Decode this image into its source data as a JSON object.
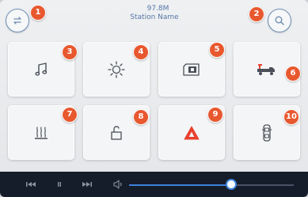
{
  "header": {
    "frequency": "97.8M",
    "station_name": "Station Name"
  },
  "markers": [
    "1",
    "2",
    "3",
    "4",
    "5",
    "6",
    "7",
    "8",
    "9",
    "10"
  ],
  "tiles": [
    {
      "id": "music",
      "icon": "music-note-icon"
    },
    {
      "id": "brightness",
      "icon": "sun-brightness-icon"
    },
    {
      "id": "media-card",
      "icon": "sd-card-icon"
    },
    {
      "id": "truck",
      "icon": "truck-icon"
    },
    {
      "id": "heater",
      "icon": "heater-icon"
    },
    {
      "id": "unlock",
      "icon": "unlock-icon"
    },
    {
      "id": "hazard",
      "icon": "hazard-warning-icon"
    },
    {
      "id": "car-doors",
      "icon": "car-top-view-icon"
    }
  ],
  "media": {
    "volume_level": 0.62
  },
  "colors": {
    "accent_blue": "#3d82d9",
    "marker_orange": "#e8582f",
    "hazard_red": "#e8402f",
    "bar_dark": "#151c2a"
  }
}
